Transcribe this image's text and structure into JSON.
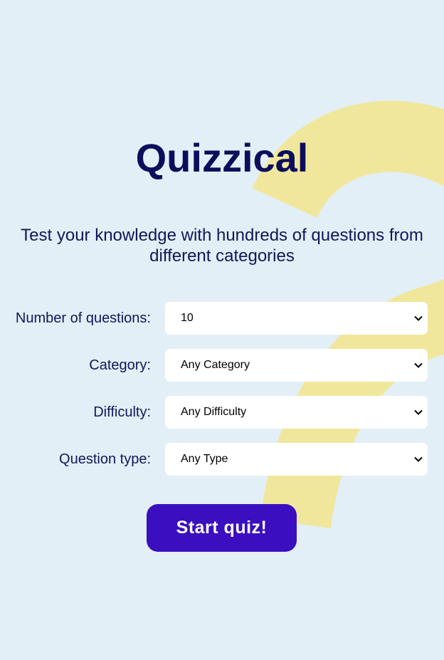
{
  "app": {
    "title": "Quizzical",
    "subtitle": "Test your knowledge with hundreds of questions from different categories"
  },
  "form": {
    "fields": [
      {
        "label": "Number of questions:",
        "value": "10"
      },
      {
        "label": "Category:",
        "value": "Any Category"
      },
      {
        "label": "Difficulty:",
        "value": "Any Difficulty"
      },
      {
        "label": "Question type:",
        "value": "Any Type"
      }
    ],
    "submit_label": "Start quiz!"
  },
  "colors": {
    "background": "#e3eff6",
    "title": "#0c0e5c",
    "text": "#13155a",
    "button": "#3b0fbf",
    "decoration": "#f0e79c"
  },
  "icons": {
    "select_arrow": "chevron-down-icon",
    "background_decoration": "question-mark-decoration"
  }
}
